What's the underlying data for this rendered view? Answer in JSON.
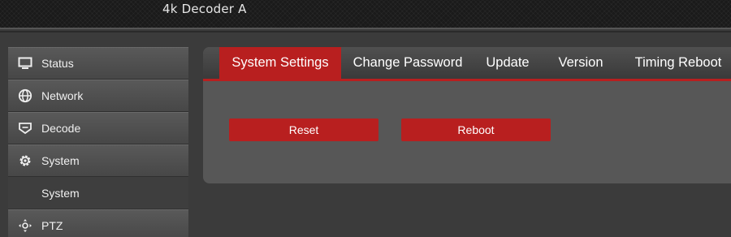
{
  "header": {
    "title": "4k Decoder  A"
  },
  "sidebar": {
    "items": [
      {
        "label": "Status",
        "icon": "monitor-icon"
      },
      {
        "label": "Network",
        "icon": "globe-icon"
      },
      {
        "label": "Decode",
        "icon": "decode-icon"
      },
      {
        "label": "System",
        "icon": "gear-icon"
      },
      {
        "label": "System",
        "icon": "",
        "sub": true
      },
      {
        "label": "PTZ",
        "icon": "ptz-icon"
      }
    ]
  },
  "tabs": [
    {
      "label": "System Settings",
      "active": true
    },
    {
      "label": "Change Password",
      "active": false
    },
    {
      "label": "Update",
      "active": false
    },
    {
      "label": "Version",
      "active": false
    },
    {
      "label": "Timing Reboot",
      "active": false
    }
  ],
  "actions": {
    "reset_label": "Reset",
    "reboot_label": "Reboot"
  },
  "colors": {
    "accent": "#b81f1f",
    "panel": "#575757",
    "background": "#3b3b3b"
  }
}
